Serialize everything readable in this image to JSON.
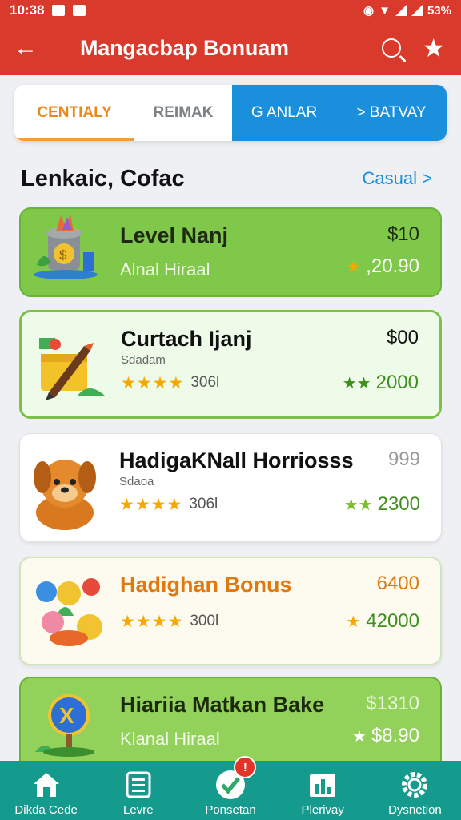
{
  "status_bar": {
    "time": "10:38",
    "right_text": "53%"
  },
  "app_bar": {
    "title": "Mangacbap Bonuam"
  },
  "tabs": [
    {
      "label": "CENTIALY"
    },
    {
      "label": "REIMAK"
    },
    {
      "label": "G ANLAR"
    },
    {
      "label": "> BATVAY"
    }
  ],
  "section": {
    "heading": "Lenkaic, Cofac",
    "more_label": "Casual >"
  },
  "cards": [
    {
      "name": "Level Nanj",
      "price": "$10",
      "subtitle": "Alnal Hiraal",
      "reward_stars": "★",
      "reward": ",20.90"
    },
    {
      "name": "Curtach Ijanj",
      "price": "$00",
      "subtitle": "Sdadam",
      "stars": "★★★★",
      "rating": "306l",
      "reward_stars": "★★",
      "reward": "2000"
    },
    {
      "name": "HadigaKNall Horriosss",
      "price": "999",
      "subtitle": "Sdaoa",
      "stars": "★★★★",
      "rating": "306l",
      "reward_stars": "★★",
      "reward": "2300"
    },
    {
      "name": "Hadighan Bonus",
      "price": "6400",
      "subtitle": "",
      "stars": "★★★★",
      "rating": "300l",
      "reward_stars": "★",
      "reward": "42000"
    },
    {
      "name": "Hiariia Matkan Bake",
      "price": "$1310",
      "subtitle": "Klanal Hiraal",
      "reward_stars": "★",
      "reward": "$8.90"
    }
  ],
  "bottom_nav": [
    {
      "label": "Dikda Cede",
      "icon": "home-icon"
    },
    {
      "label": "Levre",
      "icon": "list-icon"
    },
    {
      "label": "Ponsetan",
      "icon": "check-icon",
      "badge": "!"
    },
    {
      "label": "Plerivay",
      "icon": "chart-icon"
    },
    {
      "label": "Dysnetion",
      "icon": "gear-icon"
    }
  ],
  "colors": {
    "primary": "#d93a2b",
    "accent_blue": "#1a8fdc",
    "nav": "#159a8e",
    "green": "#80c84a",
    "orange": "#e07a10"
  }
}
